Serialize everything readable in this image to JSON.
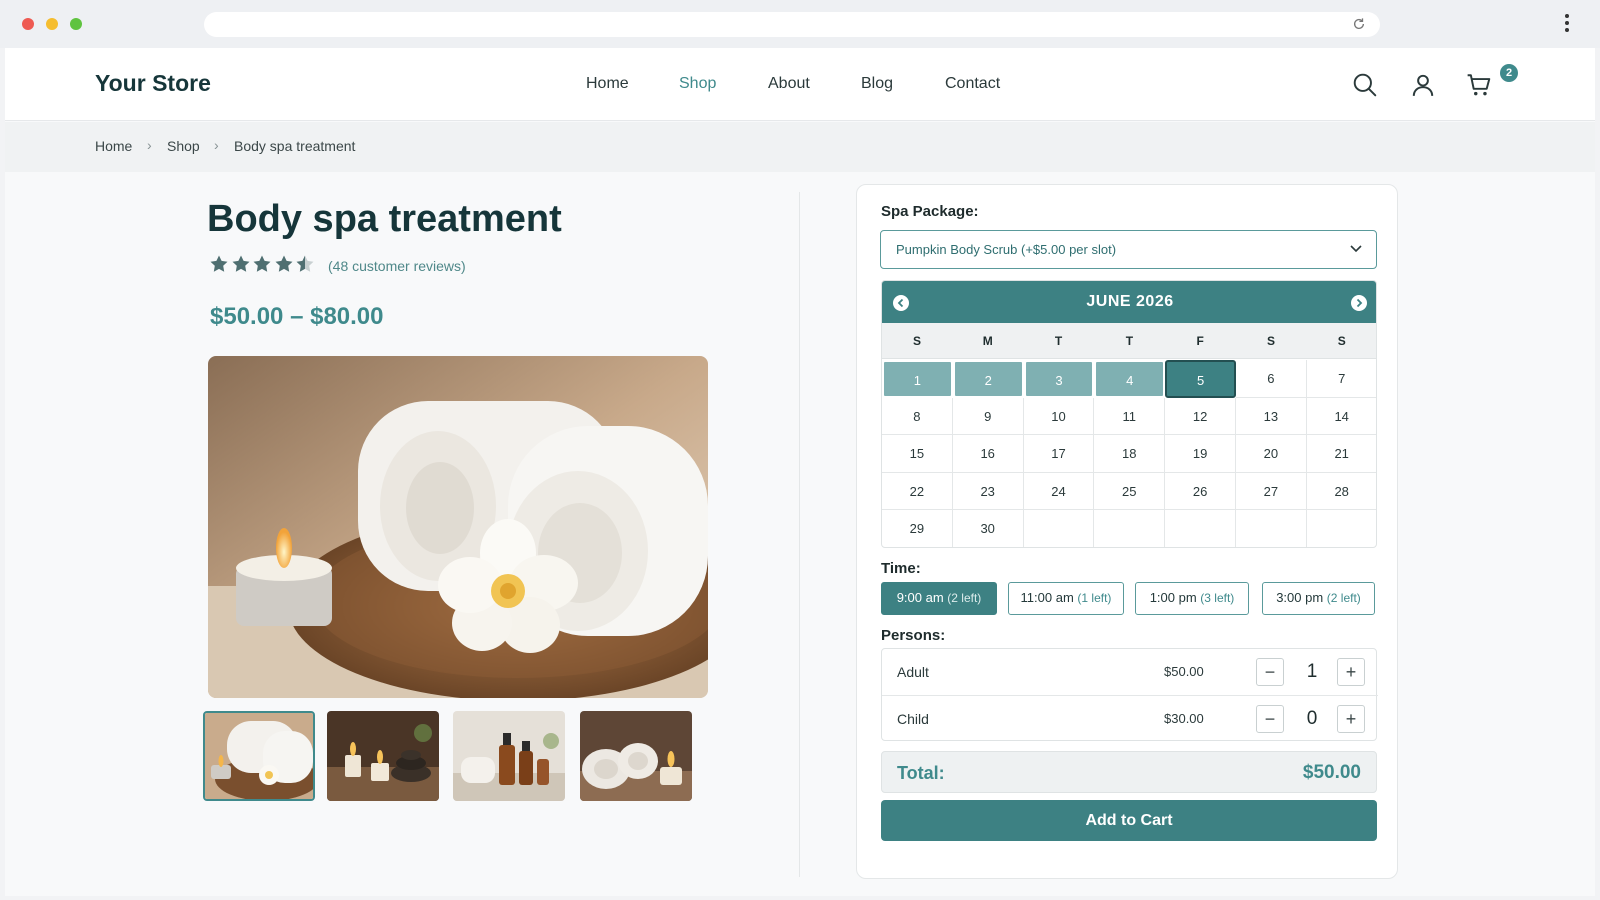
{
  "browser": {
    "dot_colors": [
      "#ee5a52",
      "#f5bd2f",
      "#5fc33f"
    ]
  },
  "header": {
    "logo": "Your Store",
    "nav": [
      {
        "label": "Home",
        "active": false
      },
      {
        "label": "Shop",
        "active": true
      },
      {
        "label": "About",
        "active": false
      },
      {
        "label": "Blog",
        "active": false
      },
      {
        "label": "Contact",
        "active": false
      }
    ],
    "icons": [
      "search-icon",
      "user-icon",
      "cart-icon"
    ],
    "cart_count": "2"
  },
  "breadcrumb": [
    "Home",
    "Shop",
    "Body spa treatment"
  ],
  "breadcrumb_sep": "›",
  "product": {
    "title": "Body spa treatment",
    "rating": 4.5,
    "rating_max": 5,
    "reviews": "(48 customer reviews)",
    "price_range": "$50.00 – $80.00",
    "thumbnails": [
      "towels-thumbnail",
      "candles-stones-thumbnail",
      "oil-bottles-thumbnail",
      "towels-candle-thumbnail"
    ]
  },
  "booking": {
    "package_label": "Spa Package:",
    "package_value": "Pumpkin Body Scrub (+$5.00 per slot)",
    "calendar": {
      "month": "JUNE 2026",
      "weekdays": [
        "S",
        "M",
        "T",
        "T",
        "F",
        "S",
        "S"
      ],
      "days": [
        "1",
        "2",
        "3",
        "4",
        "5",
        "6",
        "7",
        "8",
        "9",
        "10",
        "11",
        "12",
        "13",
        "14",
        "15",
        "16",
        "17",
        "18",
        "19",
        "20",
        "21",
        "22",
        "23",
        "24",
        "25",
        "26",
        "27",
        "28",
        "29",
        "30"
      ],
      "range_days": [
        "1",
        "2",
        "3",
        "4"
      ],
      "selected_day": "5"
    },
    "time_label": "Time:",
    "slots": [
      {
        "time": "9:00 am",
        "left": "(2 left)",
        "active": true
      },
      {
        "time": "11:00 am",
        "left": "(1 left)",
        "active": false
      },
      {
        "time": "1:00 pm",
        "left": "(3 left)",
        "active": false
      },
      {
        "time": "3:00 pm",
        "left": "(2 left)",
        "active": false
      }
    ],
    "persons_label": "Persons:",
    "persons": [
      {
        "name": "Adult",
        "price": "$50.00",
        "qty": "1"
      },
      {
        "name": "Child",
        "price": "$30.00",
        "qty": "0"
      }
    ],
    "total_label": "Total:",
    "total_value": "$50.00",
    "add_to_cart": "Add to Cart"
  },
  "colors": {
    "accent": "#3f8a8c",
    "accent_dark": "#3d8183",
    "range": "#7fb0b2",
    "title": "#16363a"
  }
}
